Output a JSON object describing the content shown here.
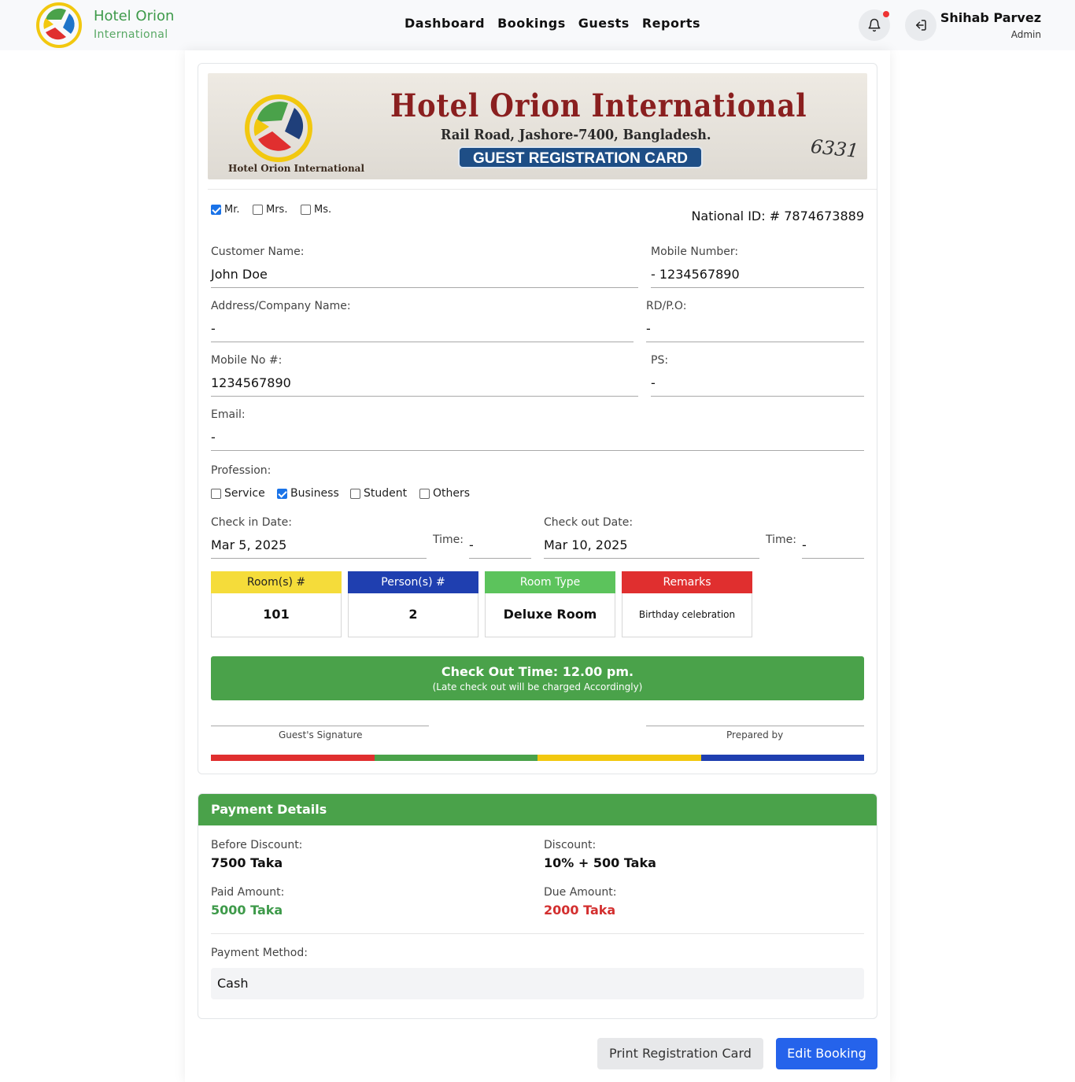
{
  "header": {
    "brand_line1": "Hotel Orion",
    "brand_line2": "International",
    "nav": [
      "Dashboard",
      "Bookings",
      "Guests",
      "Reports"
    ],
    "user_name": "Shihab Parvez",
    "user_role": "Admin",
    "icons": [
      "bell-icon",
      "logout-icon"
    ]
  },
  "card_banner": {
    "title": "Hotel Orion International",
    "address": "Rail Road, Jashore-7400, Bangladesh.",
    "badge": "GUEST REGISTRATION CARD",
    "serial": "6331",
    "logo_caption": "Hotel Orion International"
  },
  "salutation": {
    "options": [
      "Mr.",
      "Mrs.",
      "Ms."
    ],
    "checked": [
      true,
      false,
      false
    ]
  },
  "national_id": "National ID: # 7874673889",
  "fields": {
    "customer_name_label": "Customer Name:",
    "customer_name": "John Doe",
    "mobile_number_label": "Mobile Number:",
    "mobile_number": "- 1234567890",
    "address_label": "Address/Company Name:",
    "address": "-",
    "rdpo_label": "RD/P.O:",
    "rdpo": "-",
    "mobile_no_label": "Mobile No #:",
    "mobile_no": "1234567890",
    "ps_label": "PS:",
    "ps": "-",
    "email_label": "Email:",
    "email": "-",
    "profession_label": "Profession:"
  },
  "profession": {
    "options": [
      "Service",
      "Business",
      "Student",
      "Others"
    ],
    "checked": [
      false,
      true,
      false,
      false
    ]
  },
  "dates": {
    "checkin_label": "Check in Date:",
    "checkin": "Mar 5, 2025",
    "checkin_time_label": "Time:",
    "checkin_time": "-",
    "checkout_label": "Check out Date:",
    "checkout": "Mar 10, 2025",
    "checkout_time_label": "Time:",
    "checkout_time": "-"
  },
  "tiles": [
    {
      "header": "Room(s) #",
      "value": "101",
      "color": "#f5dc3a"
    },
    {
      "header": "Person(s) #",
      "value": "2",
      "color": "#1f3fb0"
    },
    {
      "header": "Room Type",
      "value": "Deluxe Room",
      "color": "#5cc35c"
    },
    {
      "header": "Remarks",
      "value": "Birthday celebration",
      "color": "#e02f2f"
    }
  ],
  "checkout_notice": {
    "line1": "Check Out Time: 12.00 pm.",
    "line2": "(Late check out will be charged Accordingly)"
  },
  "signatures": {
    "guest": "Guest's Signature",
    "prepared": "Prepared by"
  },
  "stripe_colors": [
    "#e02f2f",
    "#4aa24a",
    "#f2c80f",
    "#1f3fb0"
  ],
  "payment": {
    "title": "Payment Details",
    "before_discount_label": "Before Discount:",
    "before_discount": "7500 Taka",
    "discount_label": "Discount:",
    "discount": "10% + 500 Taka",
    "paid_label": "Paid Amount:",
    "paid": "5000 Taka",
    "due_label": "Due Amount:",
    "due": "2000 Taka",
    "method_label": "Payment Method:",
    "method": "Cash",
    "paid_color": "#3e9a4a",
    "due_color": "#d32f2f"
  },
  "actions": {
    "print": "Print Registration Card",
    "edit": "Edit Booking"
  }
}
